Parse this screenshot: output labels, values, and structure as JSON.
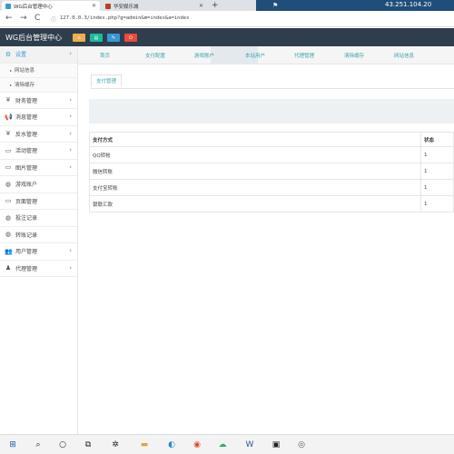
{
  "browser": {
    "tabs": [
      {
        "title": "WG后台管理中心",
        "active": true
      },
      {
        "title": "华安娱乐城",
        "active": false
      }
    ],
    "new_tab": "+",
    "ip": "43.251.104.20",
    "url": "127.0.0.3/index.php?g=admin&m=index&a=index",
    "nav": {
      "back": "←",
      "forward": "→",
      "reload": "C"
    }
  },
  "app": {
    "title": "WG后台管理中心",
    "header_buttons": [
      {
        "icon": "home-icon",
        "color": "#f0ad4e"
      },
      {
        "icon": "list-icon",
        "color": "#1abc9c"
      },
      {
        "icon": "edit-icon",
        "color": "#3a97d4"
      },
      {
        "icon": "logout-icon",
        "color": "#e74c3c"
      }
    ]
  },
  "sidebar": {
    "items": [
      {
        "label": "设置",
        "icon": "gear-icon",
        "expanded": true
      },
      {
        "label": "财务管理",
        "icon": "yen-icon"
      },
      {
        "label": "消息管理",
        "icon": "megaphone-icon"
      },
      {
        "label": "反水管理",
        "icon": "yen-icon"
      },
      {
        "label": "活动管理",
        "icon": "monitor-icon"
      },
      {
        "label": "图片管理",
        "icon": "monitor-icon"
      },
      {
        "label": "游戏账户",
        "icon": "gamepad-icon"
      },
      {
        "label": "页面管理",
        "icon": "monitor-icon"
      },
      {
        "label": "投注记录",
        "icon": "gamepad-icon"
      },
      {
        "label": "转账记录",
        "icon": "gamepad-icon"
      },
      {
        "label": "用户管理",
        "icon": "users-icon"
      },
      {
        "label": "代理管理",
        "icon": "agent-icon"
      }
    ],
    "subitems": [
      {
        "label": "网站信息"
      },
      {
        "label": "清除缓存"
      }
    ]
  },
  "nav_tabs": [
    "首页",
    "支付配置",
    "游戏账户",
    "本站用户",
    "代理管理",
    "清除缓存",
    "网站信息"
  ],
  "content": {
    "sub_tab": "支付管理",
    "table": {
      "headers": [
        "支付方式",
        "状态"
      ],
      "rows": [
        [
          "QQ转帐",
          "1"
        ],
        [
          "微信转账",
          "1"
        ],
        [
          "支付宝转账",
          "1"
        ],
        [
          "银联汇款",
          "1"
        ]
      ]
    }
  }
}
